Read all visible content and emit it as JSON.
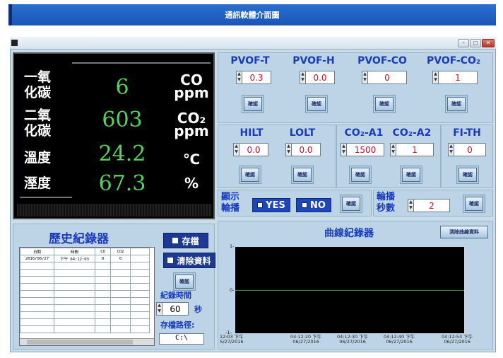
{
  "banner": {
    "title": "通訊軟體介面圖"
  },
  "window": {
    "min": "–",
    "max": "▢",
    "close": "✕"
  },
  "display": {
    "rows": [
      {
        "label_top": "一氧",
        "label_bottom": "化碳",
        "value": "6",
        "unit_top": "CO",
        "unit_bottom": "ppm"
      },
      {
        "label_top": "二氧",
        "label_bottom": "化碳",
        "value": "603",
        "unit_top": "CO₂",
        "unit_bottom": "ppm"
      },
      {
        "label": "溫度",
        "value": "24.2",
        "unit": "℃"
      },
      {
        "label": "溼度",
        "value": "67.3",
        "unit": "%"
      }
    ]
  },
  "params": {
    "confirm": "確認",
    "pvof": [
      {
        "label": "PVOF-T",
        "value": "0.3"
      },
      {
        "label": "PVOF-H",
        "value": "0.0"
      },
      {
        "label": "PVOF-CO",
        "value": "0"
      },
      {
        "label": "PVOF-CO₂",
        "value": "1"
      }
    ],
    "row2": [
      {
        "label": "HILT",
        "value": "0.0"
      },
      {
        "label": "LOLT",
        "value": "0.0"
      },
      {
        "label": "CO₂-A1",
        "value": "1500"
      },
      {
        "label": "CO₂-A2",
        "value": "1"
      },
      {
        "label": "FI-TH",
        "value": "0"
      }
    ],
    "display_rotate": {
      "line1": "顯示",
      "line2": "輪播",
      "yes": "YES",
      "no": "NO"
    },
    "rotate_seconds": {
      "line1": "輪播",
      "line2": "秒數",
      "value": "2"
    }
  },
  "history": {
    "title": "歷史紀錄器",
    "columns": [
      "日期",
      "時間",
      "CO",
      "CO2"
    ],
    "rows": [
      [
        "2016/06/27",
        "下午 04:12:03",
        "0",
        "0"
      ]
    ],
    "save": "存檔",
    "clear": "清除資料",
    "confirm": "確認",
    "interval_label": "紀錄時間",
    "interval_value": "60",
    "interval_unit": "秒",
    "path_label": "存檔路徑:",
    "path_value": "C:\\"
  },
  "curve": {
    "title": "曲線紀錄器",
    "clear": "清除曲線資料",
    "y_ticks": [
      "1-",
      "0-",
      "-1-"
    ],
    "x_ticks": [
      {
        "time": "12:03 下午",
        "date": "5/27/2016"
      },
      {
        "time": "04:12:20 下午",
        "date": "06/27/2016"
      },
      {
        "time": "04:12:30 下午",
        "date": "06/27/2016"
      },
      {
        "time": "04:12:40 下午",
        "date": "06/27/2016"
      },
      {
        "time": "04:12:53 下午",
        "date": "06/27/2016"
      }
    ]
  },
  "colors": {
    "accent": "#1f46b8",
    "value_green": "#56d35a",
    "value_red": "#c8102e"
  }
}
